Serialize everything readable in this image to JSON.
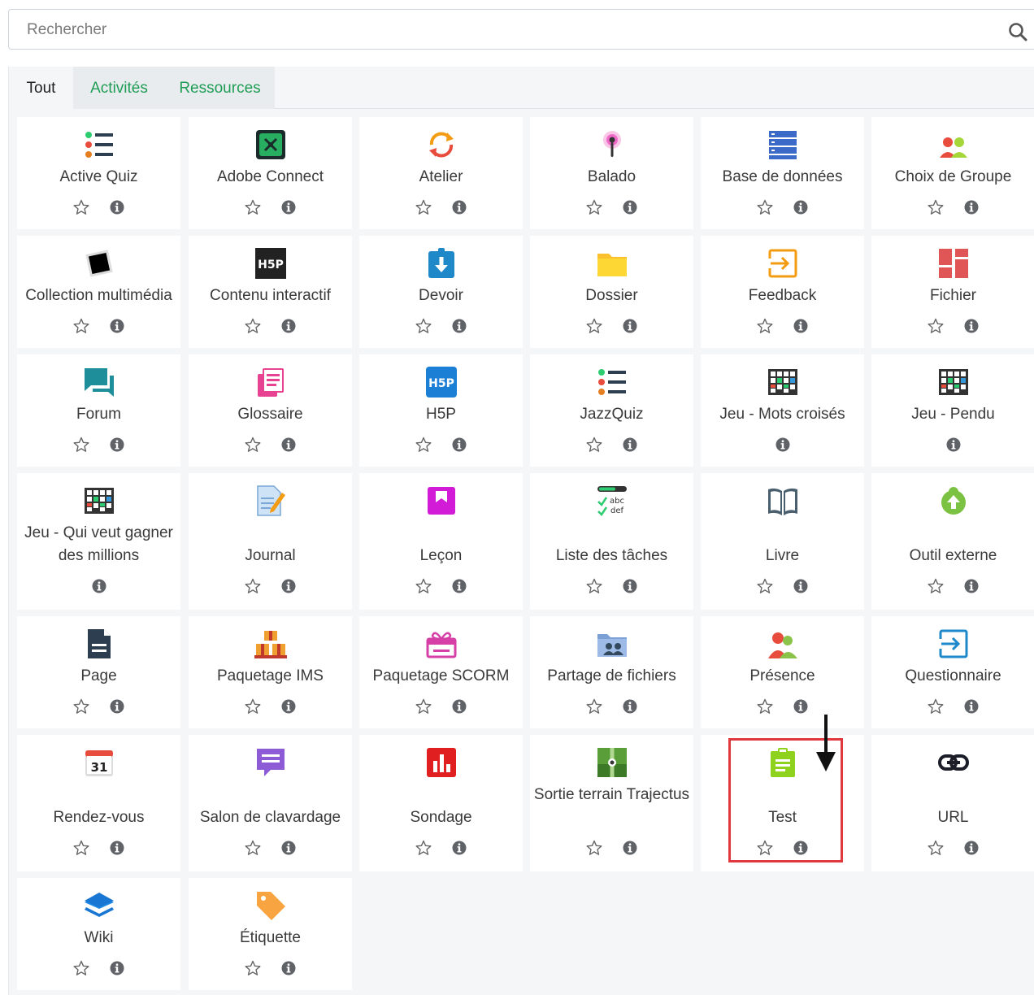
{
  "search": {
    "placeholder": "Rechercher"
  },
  "tabs": [
    {
      "label": "Tout",
      "active": true
    },
    {
      "label": "Activités",
      "active": false
    },
    {
      "label": "Ressources",
      "active": false
    }
  ],
  "colors": {
    "tab_inactive_text": "#1f9d55",
    "highlight": "#e0383e",
    "tile_bg": "#ffffff",
    "panel_bg": "#f5f6f7"
  },
  "modules": [
    {
      "label": "Active Quiz",
      "icon": "list-bullets-icon",
      "star": true
    },
    {
      "label": "Adobe Connect",
      "icon": "adobe-connect-icon",
      "star": true
    },
    {
      "label": "Atelier",
      "icon": "cycle-arrows-icon",
      "star": true
    },
    {
      "label": "Balado",
      "icon": "podcast-icon",
      "star": true
    },
    {
      "label": "Base de données",
      "icon": "database-icon",
      "star": true
    },
    {
      "label": "Choix de Groupe",
      "icon": "group-people-icon",
      "star": true
    },
    {
      "label": "Collection multimédia",
      "icon": "photo-frame-icon",
      "star": true
    },
    {
      "label": "Contenu interactif",
      "icon": "h5p-dark-icon",
      "star": true
    },
    {
      "label": "Devoir",
      "icon": "assignment-download-icon",
      "star": true
    },
    {
      "label": "Dossier",
      "icon": "folder-icon",
      "star": true
    },
    {
      "label": "Feedback",
      "icon": "feedback-arrow-icon",
      "star": true
    },
    {
      "label": "Fichier",
      "icon": "file-blocks-icon",
      "star": true
    },
    {
      "label": "Forum",
      "icon": "chat-bubbles-icon",
      "star": true
    },
    {
      "label": "Glossaire",
      "icon": "glossary-book-icon",
      "star": true
    },
    {
      "label": "H5P",
      "icon": "h5p-blue-icon",
      "star": true
    },
    {
      "label": "JazzQuiz",
      "icon": "list-bullets-icon",
      "star": true
    },
    {
      "label": "Jeu - Mots croisés",
      "icon": "game-grid-icon",
      "star": false
    },
    {
      "label": "Jeu - Pendu",
      "icon": "game-grid-icon",
      "star": false
    },
    {
      "label": "Jeu - Qui veut gagner des millions",
      "icon": "game-grid-icon",
      "star": false
    },
    {
      "label": "Journal",
      "icon": "journal-pencil-icon",
      "star": true
    },
    {
      "label": "Leçon",
      "icon": "lesson-bookmark-icon",
      "star": true
    },
    {
      "label": "Liste des tâches",
      "icon": "checklist-icon",
      "star": true
    },
    {
      "label": "Livre",
      "icon": "open-book-icon",
      "star": true
    },
    {
      "label": "Outil externe",
      "icon": "puzzle-upload-icon",
      "star": true
    },
    {
      "label": "Page",
      "icon": "page-document-icon",
      "star": true
    },
    {
      "label": "Paquetage IMS",
      "icon": "package-boxes-icon",
      "star": true
    },
    {
      "label": "Paquetage SCORM",
      "icon": "scorm-package-icon",
      "star": true
    },
    {
      "label": "Partage de fichiers",
      "icon": "shared-folder-icon",
      "star": true
    },
    {
      "label": "Présence",
      "icon": "attendance-people-icon",
      "star": true
    },
    {
      "label": "Questionnaire",
      "icon": "questionnaire-arrow-icon",
      "star": true
    },
    {
      "label": "Rendez-vous",
      "icon": "calendar-icon",
      "star": true
    },
    {
      "label": "Salon de clavardage",
      "icon": "chat-room-icon",
      "star": true
    },
    {
      "label": "Sondage",
      "icon": "poll-chart-icon",
      "star": true
    },
    {
      "label": "Sortie terrain Trajectus",
      "icon": "map-trail-icon",
      "star": true
    },
    {
      "label": "Test",
      "icon": "clipboard-test-icon",
      "star": true
    },
    {
      "label": "URL",
      "icon": "link-icon",
      "star": true
    },
    {
      "label": "Wiki",
      "icon": "layers-icon",
      "star": true
    },
    {
      "label": "Étiquette",
      "icon": "tag-icon",
      "star": true
    }
  ]
}
